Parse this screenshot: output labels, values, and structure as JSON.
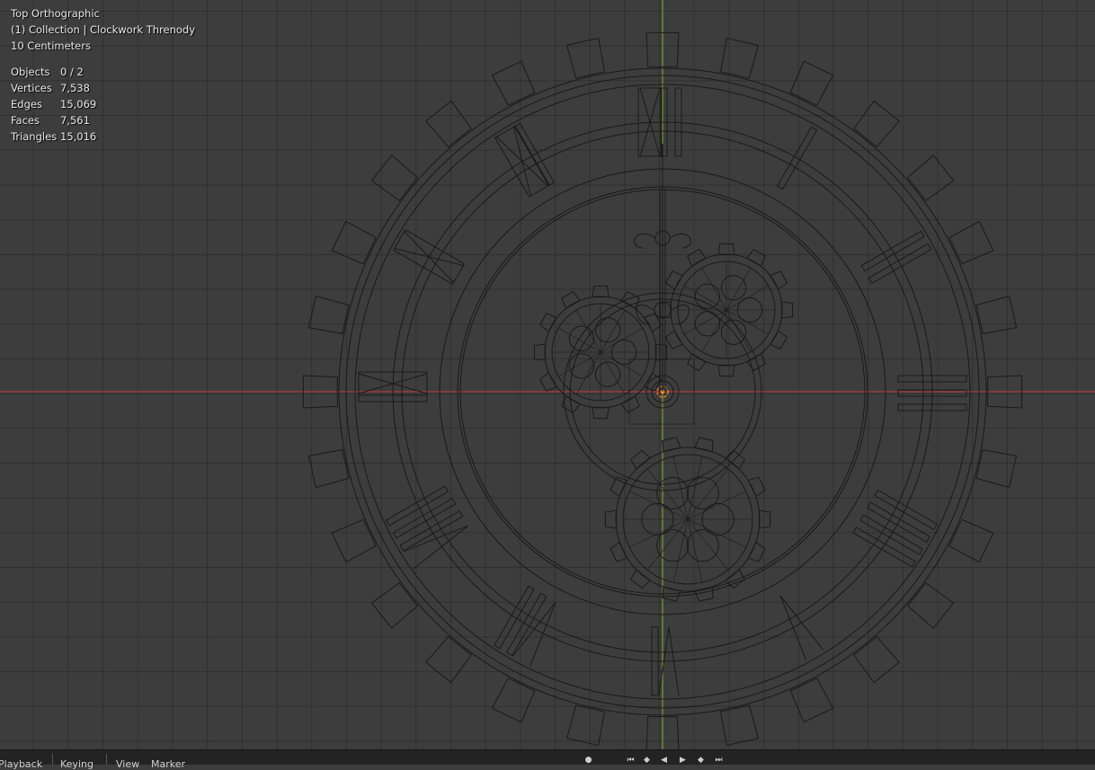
{
  "viewport": {
    "view_name": "Top Orthographic",
    "collection": "(1) Collection | Clockwork Threnody",
    "scale": "10 Centimeters",
    "stats": [
      {
        "label": "Objects",
        "value": "0 / 2"
      },
      {
        "label": "Vertices",
        "value": "7,538"
      },
      {
        "label": "Edges",
        "value": "15,069"
      },
      {
        "label": "Faces",
        "value": "7,561"
      },
      {
        "label": "Triangles",
        "value": "15,016"
      }
    ],
    "axis_colors": {
      "x": "#c63b3b",
      "y": "#7fae2d"
    },
    "wire_color": "#1a1a1a"
  },
  "timeline": {
    "menus": [
      "Playback",
      "Keying",
      "View",
      "Marker"
    ],
    "transport_icons": [
      "record-icon",
      "jump-start-icon",
      "prev-keyframe-icon",
      "play-reverse-icon",
      "play-icon",
      "next-keyframe-icon",
      "jump-end-icon"
    ]
  }
}
